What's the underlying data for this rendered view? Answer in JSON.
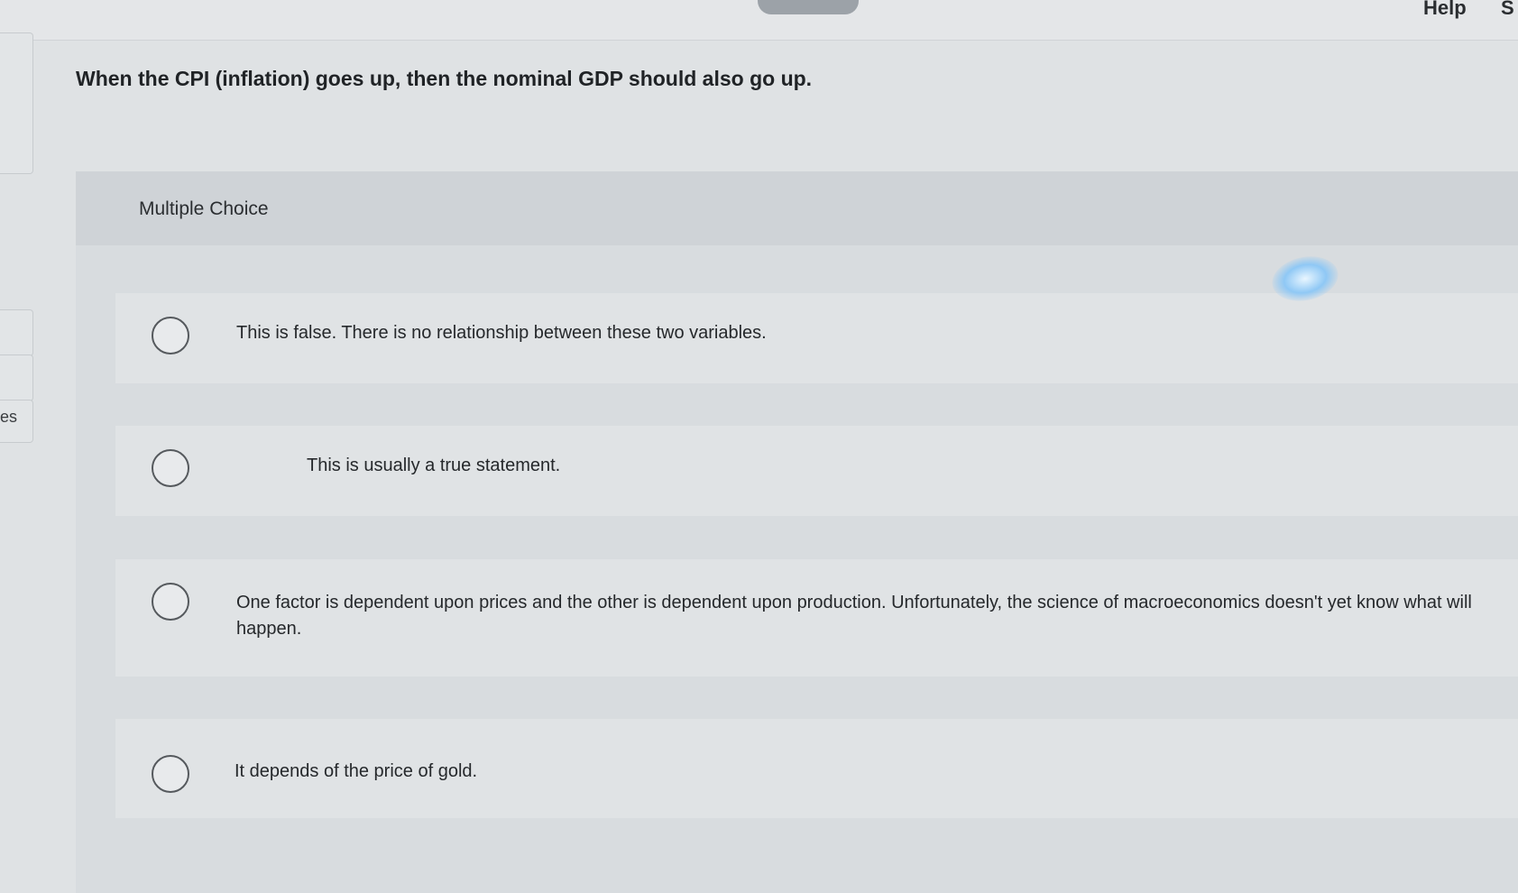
{
  "header": {
    "help_label": "Help",
    "extra_label": "S"
  },
  "sidebar": {
    "partial_label": "es"
  },
  "question": {
    "text": "When the CPI (inflation) goes up, then the nominal GDP should also go up."
  },
  "multiple_choice": {
    "heading": "Multiple Choice",
    "options": [
      {
        "text": "This is false. There is no relationship between these two variables."
      },
      {
        "text": "This is usually a true statement."
      },
      {
        "text": "One factor is dependent upon prices and the other is dependent upon production. Unfortunately, the science of macroeconomics doesn't yet know what will happen."
      },
      {
        "text": "It depends of the price of gold."
      }
    ]
  }
}
